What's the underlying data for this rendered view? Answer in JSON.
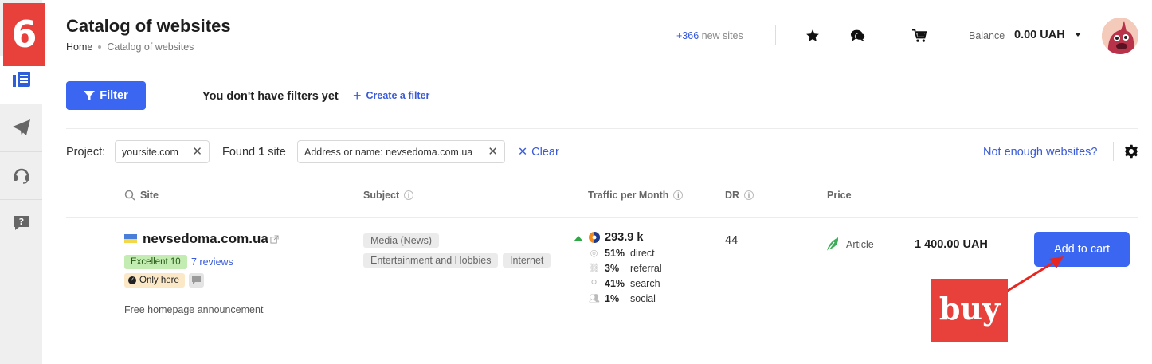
{
  "step_badge": "6",
  "header": {
    "title": "Catalog of websites",
    "breadcrumb": [
      "Home",
      "Catalog of websites"
    ],
    "new_sites_count": "+366",
    "new_sites_label": "new sites",
    "balance_label": "Balance",
    "balance_value": "0.00 UAH",
    "icons": [
      "star-icon",
      "chat-icon",
      "cart-icon"
    ]
  },
  "sidebar": {
    "items": [
      "catalog-icon",
      "send-icon",
      "support-headset-icon",
      "help-icon"
    ]
  },
  "filters": {
    "button_label": "Filter",
    "empty_text": "You don't have filters yet",
    "create_label": "Create a filter"
  },
  "project_row": {
    "project_label": "Project:",
    "project_value": "yoursite.com",
    "found_prefix": "Found",
    "found_count": "1",
    "found_suffix": "site",
    "search_chip": "Address or name: nevsedoma.com.ua",
    "clear_label": "Clear",
    "not_enough_label": "Not enough websites?"
  },
  "table": {
    "columns": {
      "site": "Site",
      "subject": "Subject",
      "traffic": "Traffic per Month",
      "dr": "DR",
      "price": "Price"
    },
    "rows": [
      {
        "site_name": "nevsedoma.com.ua",
        "rating_badge": "Excellent 10",
        "reviews": "7 reviews",
        "only_here": "Only here",
        "promo": "Free homepage announcement",
        "subjects": [
          "Media (News)",
          "Entertainment and Hobbies",
          "Internet"
        ],
        "traffic_total": "293.9 k",
        "traffic_sources": [
          {
            "pct": "51%",
            "label": "direct"
          },
          {
            "pct": "3%",
            "label": "referral"
          },
          {
            "pct": "41%",
            "label": "search"
          },
          {
            "pct": "1%",
            "label": "social"
          }
        ],
        "dr": "44",
        "price_type": "Article",
        "price": "1 400.00 UAH",
        "cta": "Add to cart"
      }
    ]
  },
  "annotation": {
    "label": "buy"
  },
  "colors": {
    "accent": "#3a66f2",
    "link": "#3a5bd9",
    "annotation_red": "#e8413b",
    "success_green": "#2fa845"
  }
}
